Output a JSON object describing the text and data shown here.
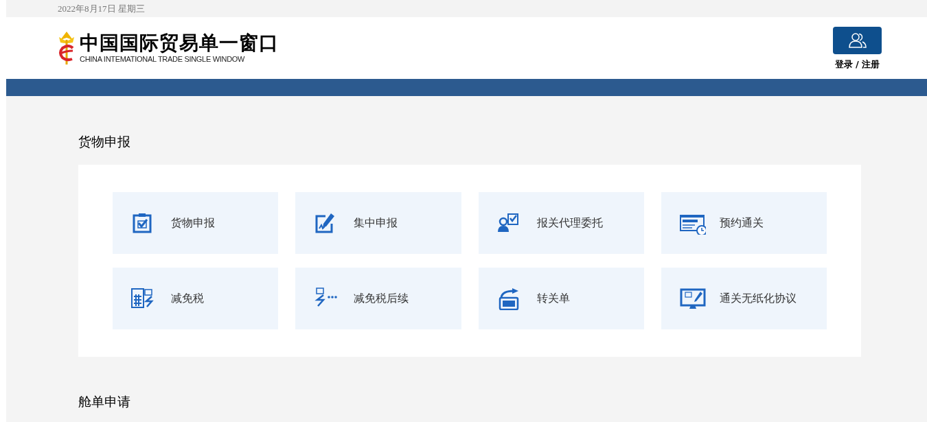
{
  "date": "2022年8月17日 星期三",
  "logo": {
    "title": "中国国际贸易单一窗口",
    "subtitle": "CHINA INTEMATIONAL TRADE SINGLE WINDOW"
  },
  "login": {
    "label": "登录 / 注册"
  },
  "sections": [
    {
      "title": "货物申报",
      "tiles": [
        {
          "label": "货物申报"
        },
        {
          "label": "集中申报"
        },
        {
          "label": "报关代理委托"
        },
        {
          "label": "预约通关"
        },
        {
          "label": "减免税"
        },
        {
          "label": "减免税后续"
        },
        {
          "label": "转关单"
        },
        {
          "label": "通关无纸化协议"
        }
      ]
    },
    {
      "title": "舱单申请"
    }
  ]
}
